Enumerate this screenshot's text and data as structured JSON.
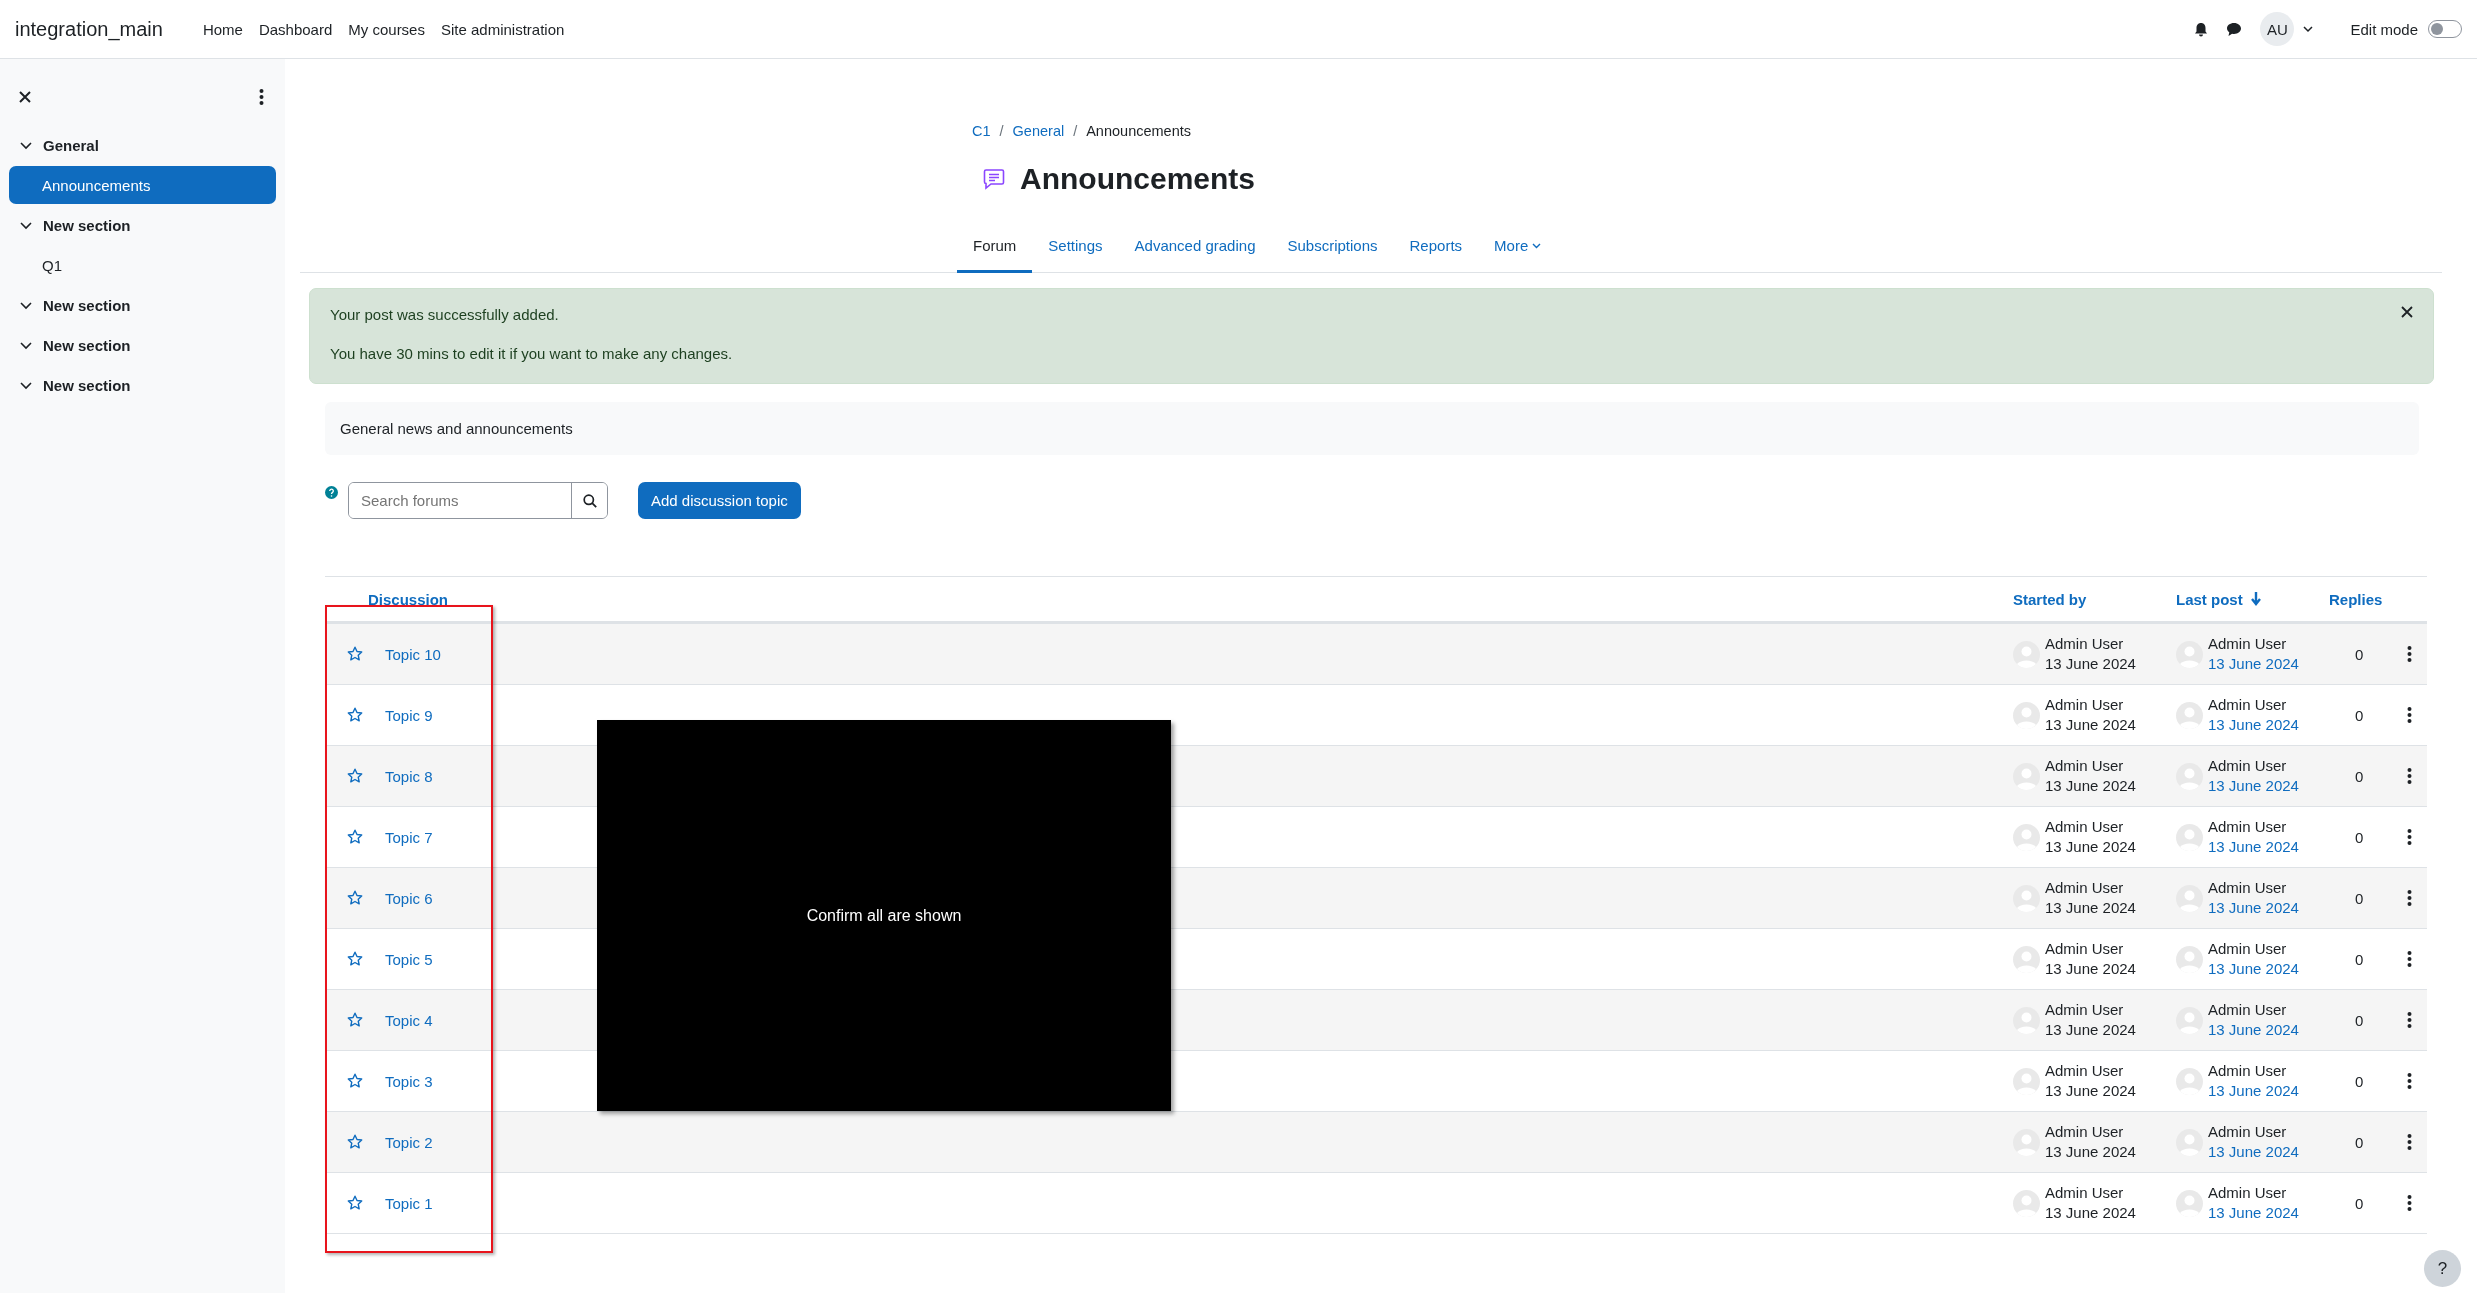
{
  "topbar": {
    "site_name": "integration_main",
    "nav": [
      {
        "label": "Home"
      },
      {
        "label": "Dashboard"
      },
      {
        "label": "My courses"
      },
      {
        "label": "Site administration"
      }
    ],
    "avatar_initials": "AU",
    "edit_mode": {
      "label": "Edit mode",
      "on": false
    }
  },
  "sidebar": {
    "items": [
      {
        "label": "General",
        "expanded": true,
        "children": [
          {
            "label": "Announcements",
            "selected": true
          }
        ]
      },
      {
        "label": "New section",
        "expanded": true,
        "children": [
          {
            "label": "Q1",
            "selected": false
          }
        ]
      },
      {
        "label": "New section",
        "expanded": true
      },
      {
        "label": "New section",
        "expanded": true
      },
      {
        "label": "New section",
        "expanded": true
      }
    ]
  },
  "breadcrumb": [
    {
      "label": "C1",
      "link": true
    },
    {
      "separator": "/",
      "label": "General",
      "link": true
    },
    {
      "separator": "/",
      "label": "Announcements",
      "link": false
    }
  ],
  "title": "Announcements",
  "tabs": [
    {
      "label": "Forum",
      "selected": true,
      "menu": false
    },
    {
      "label": "Settings",
      "selected": false,
      "menu": false
    },
    {
      "label": "Advanced grading",
      "selected": false,
      "menu": false
    },
    {
      "label": "Subscriptions",
      "selected": false,
      "menu": false
    },
    {
      "label": "Reports",
      "selected": false,
      "menu": false
    },
    {
      "label": "More",
      "selected": false,
      "menu": true
    }
  ],
  "alert": {
    "lines": [
      "Your post was successfully added.",
      "You have 30 mins to edit it if you want to make any changes."
    ]
  },
  "description": "General news and announcements",
  "search": {
    "placeholder": "Search forums"
  },
  "add_button": "Add discussion topic",
  "table": {
    "columns": [
      {
        "label": "Discussion",
        "sorted": false
      },
      {
        "label": "Started by",
        "sorted": false
      },
      {
        "label": "Last post",
        "sorted": true
      },
      {
        "label": "Replies",
        "sorted": false
      }
    ],
    "rows": [
      {
        "topic": "Topic 10",
        "starred": false,
        "started_by": {
          "name": "Admin User",
          "date": "13 June 2024"
        },
        "last_post": {
          "name": "Admin User",
          "date": "13 June 2024"
        },
        "replies": "0"
      },
      {
        "topic": "Topic 9",
        "starred": false,
        "started_by": {
          "name": "Admin User",
          "date": "13 June 2024"
        },
        "last_post": {
          "name": "Admin User",
          "date": "13 June 2024"
        },
        "replies": "0"
      },
      {
        "topic": "Topic 8",
        "starred": false,
        "started_by": {
          "name": "Admin User",
          "date": "13 June 2024"
        },
        "last_post": {
          "name": "Admin User",
          "date": "13 June 2024"
        },
        "replies": "0"
      },
      {
        "topic": "Topic 7",
        "starred": false,
        "started_by": {
          "name": "Admin User",
          "date": "13 June 2024"
        },
        "last_post": {
          "name": "Admin User",
          "date": "13 June 2024"
        },
        "replies": "0"
      },
      {
        "topic": "Topic 6",
        "starred": false,
        "started_by": {
          "name": "Admin User",
          "date": "13 June 2024"
        },
        "last_post": {
          "name": "Admin User",
          "date": "13 June 2024"
        },
        "replies": "0"
      },
      {
        "topic": "Topic 5",
        "starred": false,
        "started_by": {
          "name": "Admin User",
          "date": "13 June 2024"
        },
        "last_post": {
          "name": "Admin User",
          "date": "13 June 2024"
        },
        "replies": "0"
      },
      {
        "topic": "Topic 4",
        "starred": false,
        "started_by": {
          "name": "Admin User",
          "date": "13 June 2024"
        },
        "last_post": {
          "name": "Admin User",
          "date": "13 June 2024"
        },
        "replies": "0"
      },
      {
        "topic": "Topic 3",
        "starred": false,
        "started_by": {
          "name": "Admin User",
          "date": "13 June 2024"
        },
        "last_post": {
          "name": "Admin User",
          "date": "13 June 2024"
        },
        "replies": "0"
      },
      {
        "topic": "Topic 2",
        "starred": false,
        "started_by": {
          "name": "Admin User",
          "date": "13 June 2024"
        },
        "last_post": {
          "name": "Admin User",
          "date": "13 June 2024"
        },
        "replies": "0"
      },
      {
        "topic": "Topic 1",
        "starred": false,
        "started_by": {
          "name": "Admin User",
          "date": "13 June 2024"
        },
        "last_post": {
          "name": "Admin User",
          "date": "13 June 2024"
        },
        "replies": "0"
      }
    ]
  },
  "overlay": {
    "text": "Confirm all are shown"
  },
  "help_button": "?"
}
